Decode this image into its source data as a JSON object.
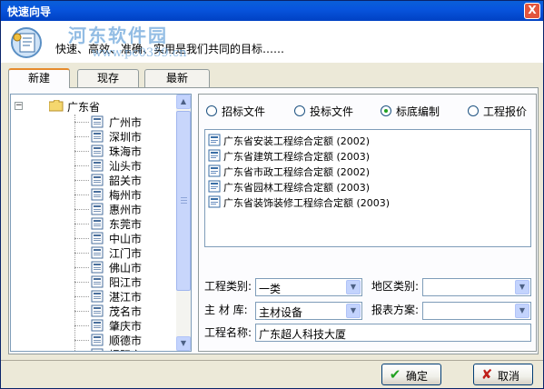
{
  "window": {
    "title": "快速向导",
    "close_label": "X"
  },
  "header": {
    "slogan": "快速、高效、准确、实用是我们共同的目标……",
    "watermark_title": "河东软件园",
    "watermark_url": "www.pc0359.cn"
  },
  "tabs": [
    {
      "label": "新建",
      "active": true
    },
    {
      "label": "现存",
      "active": false
    },
    {
      "label": "最新",
      "active": false
    }
  ],
  "tree": {
    "root": {
      "label": "广东省",
      "expander": "−",
      "icon": "folder-icon"
    },
    "cities": [
      "广州市",
      "深圳市",
      "珠海市",
      "汕头市",
      "韶关市",
      "梅州市",
      "惠州市",
      "东莞市",
      "中山市",
      "江门市",
      "佛山市",
      "阳江市",
      "湛江市",
      "茂名市",
      "肇庆市",
      "顺德市",
      "揭阳市"
    ]
  },
  "radios": [
    {
      "label": "招标文件",
      "checked": false
    },
    {
      "label": "投标文件",
      "checked": false
    },
    {
      "label": "标底编制",
      "checked": true
    },
    {
      "label": "工程报价",
      "checked": false
    }
  ],
  "documents": [
    "广东省安装工程综合定额 (2002)",
    "广东省建筑工程综合定额 (2003)",
    "广东省市政工程综合定额 (2002)",
    "广东省园林工程综合定额 (2003)",
    "广东省装饰装修工程综合定额 (2003)"
  ],
  "form": {
    "project_type_label": "工程类别:",
    "project_type_value": "一类",
    "region_type_label": "地区类别:",
    "region_type_value": "",
    "material_lib_label": "主 材 库:",
    "material_lib_value": "主材设备",
    "report_scheme_label": "报表方案:",
    "report_scheme_value": "",
    "project_name_label": "工程名称:",
    "project_name_value": "广东超人科技大厦"
  },
  "buttons": {
    "ok_label": "确定",
    "cancel_label": "取消"
  },
  "colors": {
    "titlebar": "#0855dd",
    "accent_ok": "#21a121",
    "accent_cancel": "#c0201a"
  }
}
